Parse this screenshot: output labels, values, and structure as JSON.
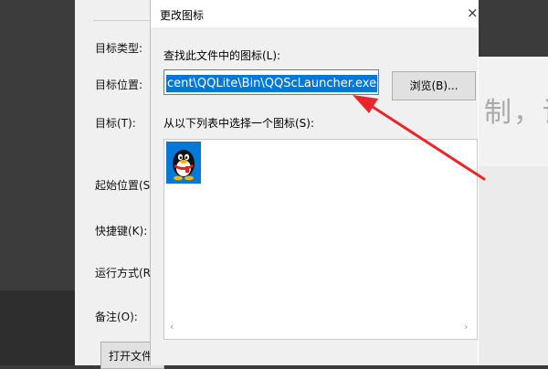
{
  "properties_panel": {
    "labels": {
      "target_type": "目标类型:",
      "target_location": "目标位置:",
      "target": "目标(T):",
      "start_location": "起始位置(S",
      "shortcut_key": "快捷键(K):",
      "run_mode": "运行方式(R",
      "comment": "备注(O):"
    },
    "open_file_button": "打开文件"
  },
  "dialog": {
    "title": "更改图标",
    "close_glyph": "×",
    "find_label": "查找此文件中的图标(L):",
    "path_value": "cent\\QQLite\\Bin\\QQScLauncher.exe",
    "browse_button": "浏览(B)...",
    "list_label": "从以下列表中选择一个图标(S):",
    "scroll_left_glyph": "‹",
    "scroll_right_glyph": "›"
  },
  "background": {
    "right_text": "制，请"
  },
  "colors": {
    "selection": "#0078d7",
    "annotation_arrow": "#e8262b"
  },
  "icons": {
    "qq": "qq-penguin-icon"
  }
}
